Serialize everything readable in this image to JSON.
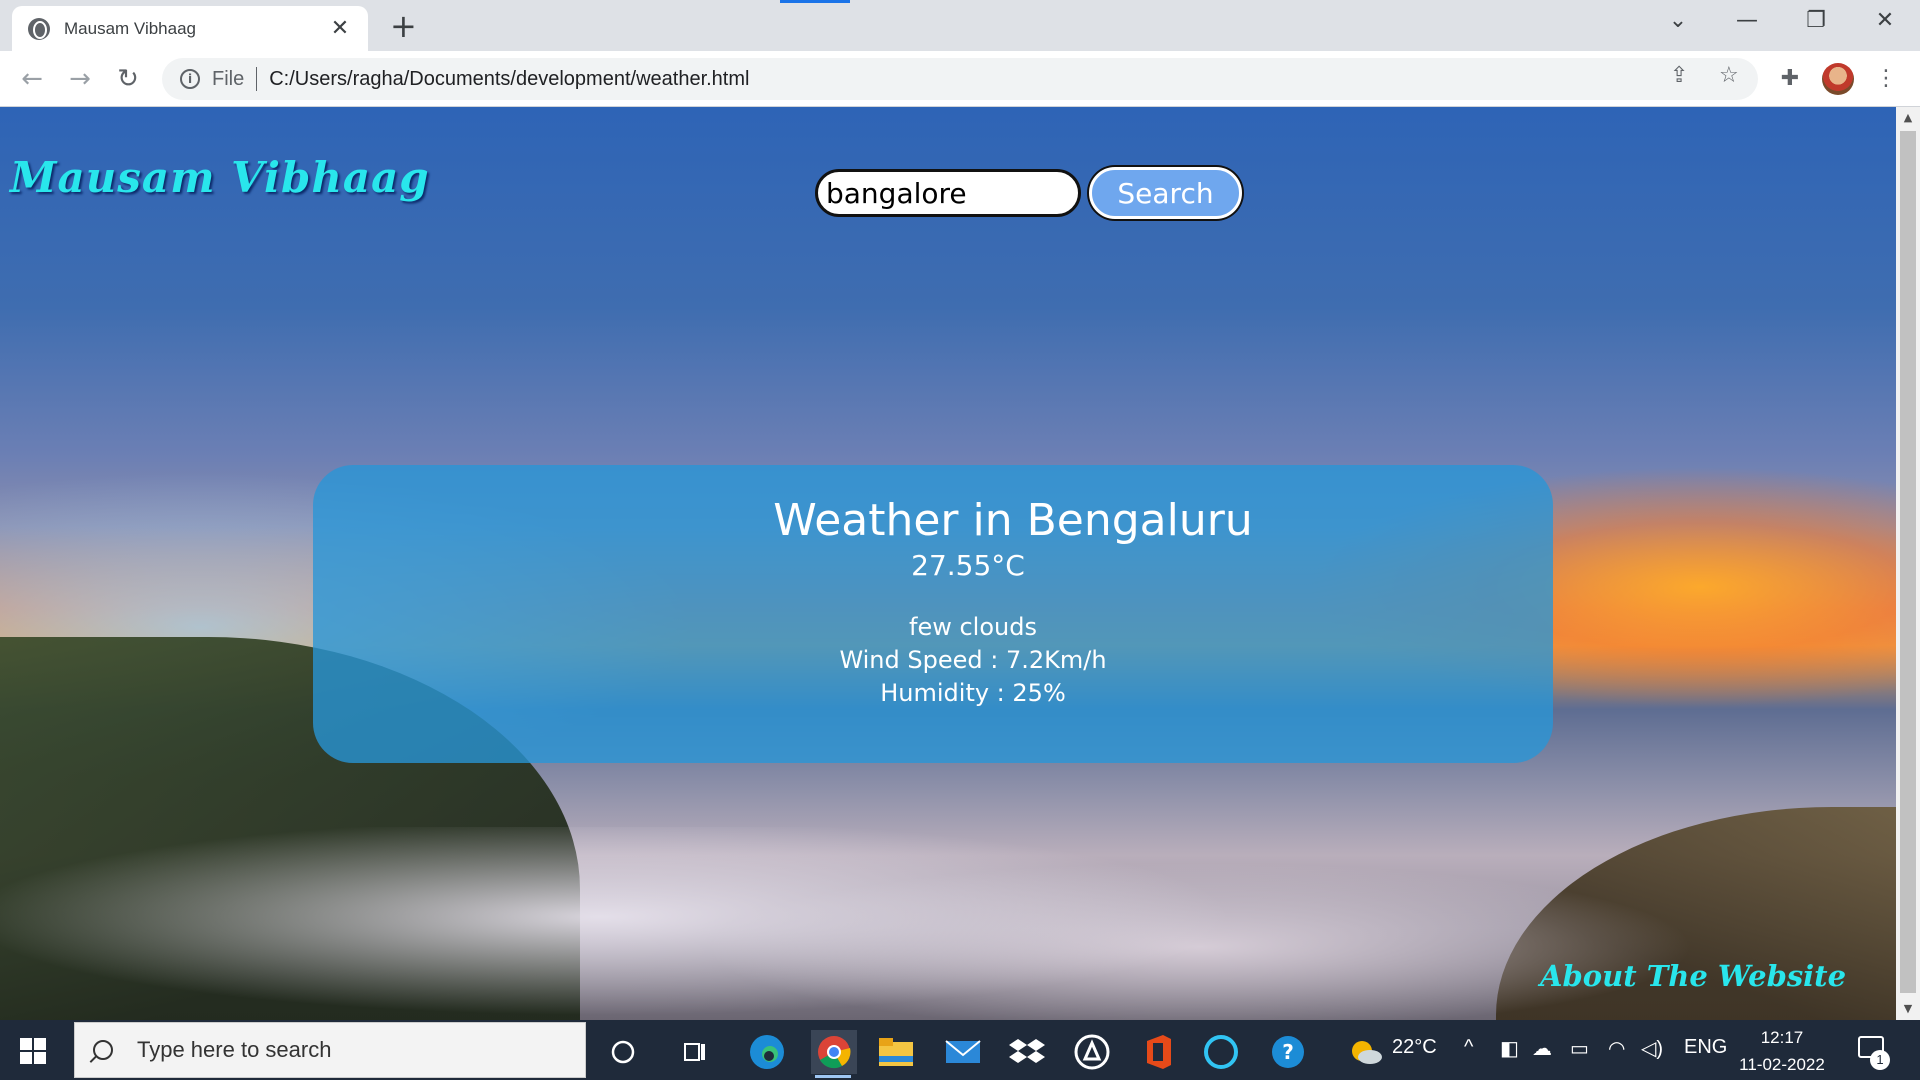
{
  "browser": {
    "tab_title": "Mausam Vibhaag",
    "tab_close": "✕",
    "new_tab": "+",
    "scheme_label": "File",
    "url": "C:/Users/ragha/Documents/development/weather.html",
    "icons": [
      "globe-icon",
      "back-icon",
      "forward-icon",
      "reload-icon",
      "info-icon",
      "share-icon",
      "star-icon",
      "extensions-icon",
      "avatar",
      "menu-icon"
    ]
  },
  "page": {
    "logo": "Mausam Vibhaag",
    "search": {
      "value": "bangalore",
      "button_label": "Search"
    },
    "weather": {
      "heading": "Weather in Bengaluru",
      "temperature": "27.55°C",
      "description": "few clouds",
      "wind": "Wind Speed : 7.2Km/h",
      "humidity": "Humidity : 25%"
    },
    "about_link": "About The Website",
    "accent_color": "#29e6ec",
    "card_color": "#2896d7"
  },
  "taskbar": {
    "search_placeholder": "Type here to search",
    "weather_temp": "22°C",
    "language": "ENG",
    "time": "12:17",
    "date": "11-02-2022",
    "notification_count": "1"
  }
}
